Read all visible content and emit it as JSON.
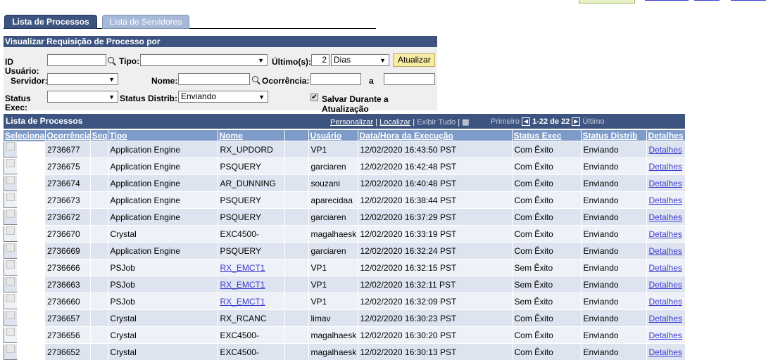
{
  "tabs": [
    {
      "label": "Lista de Processos"
    },
    {
      "label": "Lista de Servidores"
    }
  ],
  "criteria": {
    "title": "Visualizar Requisição de Processo por",
    "id_usuario_label_1": "ID",
    "id_usuario_label_2": "Usuário:",
    "id_usuario_value": "",
    "tipo_label": "Tipo:",
    "tipo_value": "",
    "ultimos_label": "Último(s):",
    "ultimos_value": "2",
    "periodo_value": "Dias",
    "atualizar_label": "Atualizar",
    "servidor_label": "Servidor:",
    "servidor_value": "",
    "nome_label": "Nome:",
    "nome_value": "",
    "ocorrencia_label": "Ocorrência:",
    "ocorrencia_de": "",
    "a_label": "a",
    "ocorrencia_ate": "",
    "status_exec_label_1": "Status",
    "status_exec_label_2": "Exec:",
    "status_exec_value": "",
    "status_distrib_label": "Status Distrib:",
    "status_distrib_value": "Enviando",
    "salvar_label": "Salvar Durante a Atualização",
    "salvar_checked": true
  },
  "grid": {
    "title": "Lista de Processos",
    "personalizar": "Personalizar",
    "localizar": "Localizar",
    "exibir_tudo": "Exibir Tudo",
    "primeiro": "Primeiro",
    "range": "1-22 de 22",
    "ultimo": "Último",
    "columns": [
      "Selecionar",
      "Ocorrência",
      "Seq",
      "Tipo",
      "Nome",
      "",
      "Usuário",
      "Data/Hora da Execução",
      "Status Exec",
      "Status Distrib",
      "Detalhes"
    ],
    "rows": [
      {
        "ocorrencia": "2736677",
        "seq": "",
        "tipo": "Application Engine",
        "nome": "RX_UPDORD",
        "nome_link": false,
        "usuario": "VP1",
        "data": "12/02/2020 16:43:50 PST",
        "status_exec": "Com Êxito",
        "status_distrib": "Enviando",
        "detalhes": "Detalhes"
      },
      {
        "ocorrencia": "2736675",
        "seq": "",
        "tipo": "Application Engine",
        "nome": "PSQUERY",
        "nome_link": false,
        "usuario": "garciaren",
        "data": "12/02/2020 16:42:48 PST",
        "status_exec": "Com Êxito",
        "status_distrib": "Enviando",
        "detalhes": "Detalhes"
      },
      {
        "ocorrencia": "2736674",
        "seq": "",
        "tipo": "Application Engine",
        "nome": "AR_DUNNING",
        "nome_link": false,
        "usuario": "souzani",
        "data": "12/02/2020 16:40:48 PST",
        "status_exec": "Com Êxito",
        "status_distrib": "Enviando",
        "detalhes": "Detalhes"
      },
      {
        "ocorrencia": "2736673",
        "seq": "",
        "tipo": "Application Engine",
        "nome": "PSQUERY",
        "nome_link": false,
        "usuario": "aparecidaa",
        "data": "12/02/2020 16:38:44 PST",
        "status_exec": "Com Êxito",
        "status_distrib": "Enviando",
        "detalhes": "Detalhes"
      },
      {
        "ocorrencia": "2736672",
        "seq": "",
        "tipo": "Application Engine",
        "nome": "PSQUERY",
        "nome_link": false,
        "usuario": "garciaren",
        "data": "12/02/2020 16:37:29 PST",
        "status_exec": "Com Êxito",
        "status_distrib": "Enviando",
        "detalhes": "Detalhes"
      },
      {
        "ocorrencia": "2736670",
        "seq": "",
        "tipo": "Crystal",
        "nome": "EXC4500-",
        "nome_link": false,
        "usuario": "magalhaesk",
        "data": "12/02/2020 16:33:19 PST",
        "status_exec": "Com Êxito",
        "status_distrib": "Enviando",
        "detalhes": "Detalhes"
      },
      {
        "ocorrencia": "2736669",
        "seq": "",
        "tipo": "Application Engine",
        "nome": "PSQUERY",
        "nome_link": false,
        "usuario": "garciaren",
        "data": "12/02/2020 16:32:24 PST",
        "status_exec": "Com Êxito",
        "status_distrib": "Enviando",
        "detalhes": "Detalhes"
      },
      {
        "ocorrencia": "2736666",
        "seq": "",
        "tipo": "PSJob",
        "nome": "RX_EMCT1",
        "nome_link": true,
        "usuario": "VP1",
        "data": "12/02/2020 16:32:15 PST",
        "status_exec": "Sem Êxito",
        "status_distrib": "Enviando",
        "detalhes": "Detalhes"
      },
      {
        "ocorrencia": "2736663",
        "seq": "",
        "tipo": "PSJob",
        "nome": "RX_EMCT1",
        "nome_link": true,
        "usuario": "VP1",
        "data": "12/02/2020 16:32:11 PST",
        "status_exec": "Sem Êxito",
        "status_distrib": "Enviando",
        "detalhes": "Detalhes"
      },
      {
        "ocorrencia": "2736660",
        "seq": "",
        "tipo": "PSJob",
        "nome": "RX_EMCT1",
        "nome_link": true,
        "usuario": "VP1",
        "data": "12/02/2020 16:32:09 PST",
        "status_exec": "Sem Êxito",
        "status_distrib": "Enviando",
        "detalhes": "Detalhes"
      },
      {
        "ocorrencia": "2736657",
        "seq": "",
        "tipo": "Crystal",
        "nome": "RX_RCANC",
        "nome_link": false,
        "usuario": "limav",
        "data": "12/02/2020 16:30:23 PST",
        "status_exec": "Com Êxito",
        "status_distrib": "Enviando",
        "detalhes": "Detalhes"
      },
      {
        "ocorrencia": "2736656",
        "seq": "",
        "tipo": "Crystal",
        "nome": "EXC4500-",
        "nome_link": false,
        "usuario": "magalhaesk",
        "data": "12/02/2020 16:30:20 PST",
        "status_exec": "Com Êxito",
        "status_distrib": "Enviando",
        "detalhes": "Detalhes"
      },
      {
        "ocorrencia": "2736652",
        "seq": "",
        "tipo": "Crystal",
        "nome": "EXC4500-",
        "nome_link": false,
        "usuario": "magalhaesk",
        "data": "12/02/2020 16:30:13 PST",
        "status_exec": "Com Êxito",
        "status_distrib": "Enviando",
        "detalhes": "Detalhes"
      }
    ]
  }
}
